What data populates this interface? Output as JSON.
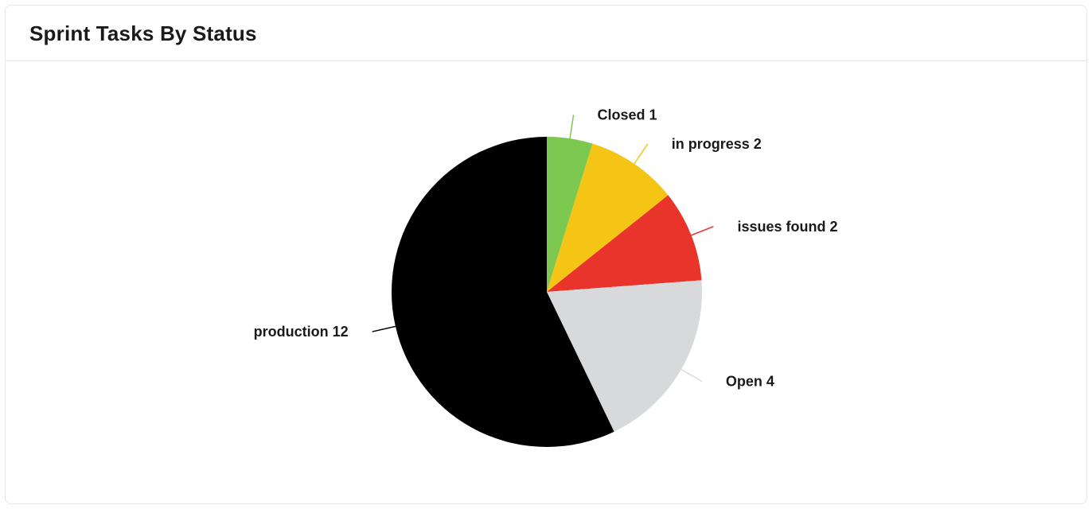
{
  "card": {
    "title": "Sprint Tasks By Status"
  },
  "chart_data": {
    "type": "pie",
    "title": "Sprint Tasks By Status",
    "series": [
      {
        "name": "Closed",
        "value": 1,
        "color": "#7cc850"
      },
      {
        "name": "in progress",
        "value": 2,
        "color": "#f5c516"
      },
      {
        "name": "issues found",
        "value": 2,
        "color": "#e9342b"
      },
      {
        "name": "Open",
        "value": 4,
        "color": "#d7d9db"
      },
      {
        "name": "production",
        "value": 12,
        "color": "#000000"
      }
    ]
  }
}
